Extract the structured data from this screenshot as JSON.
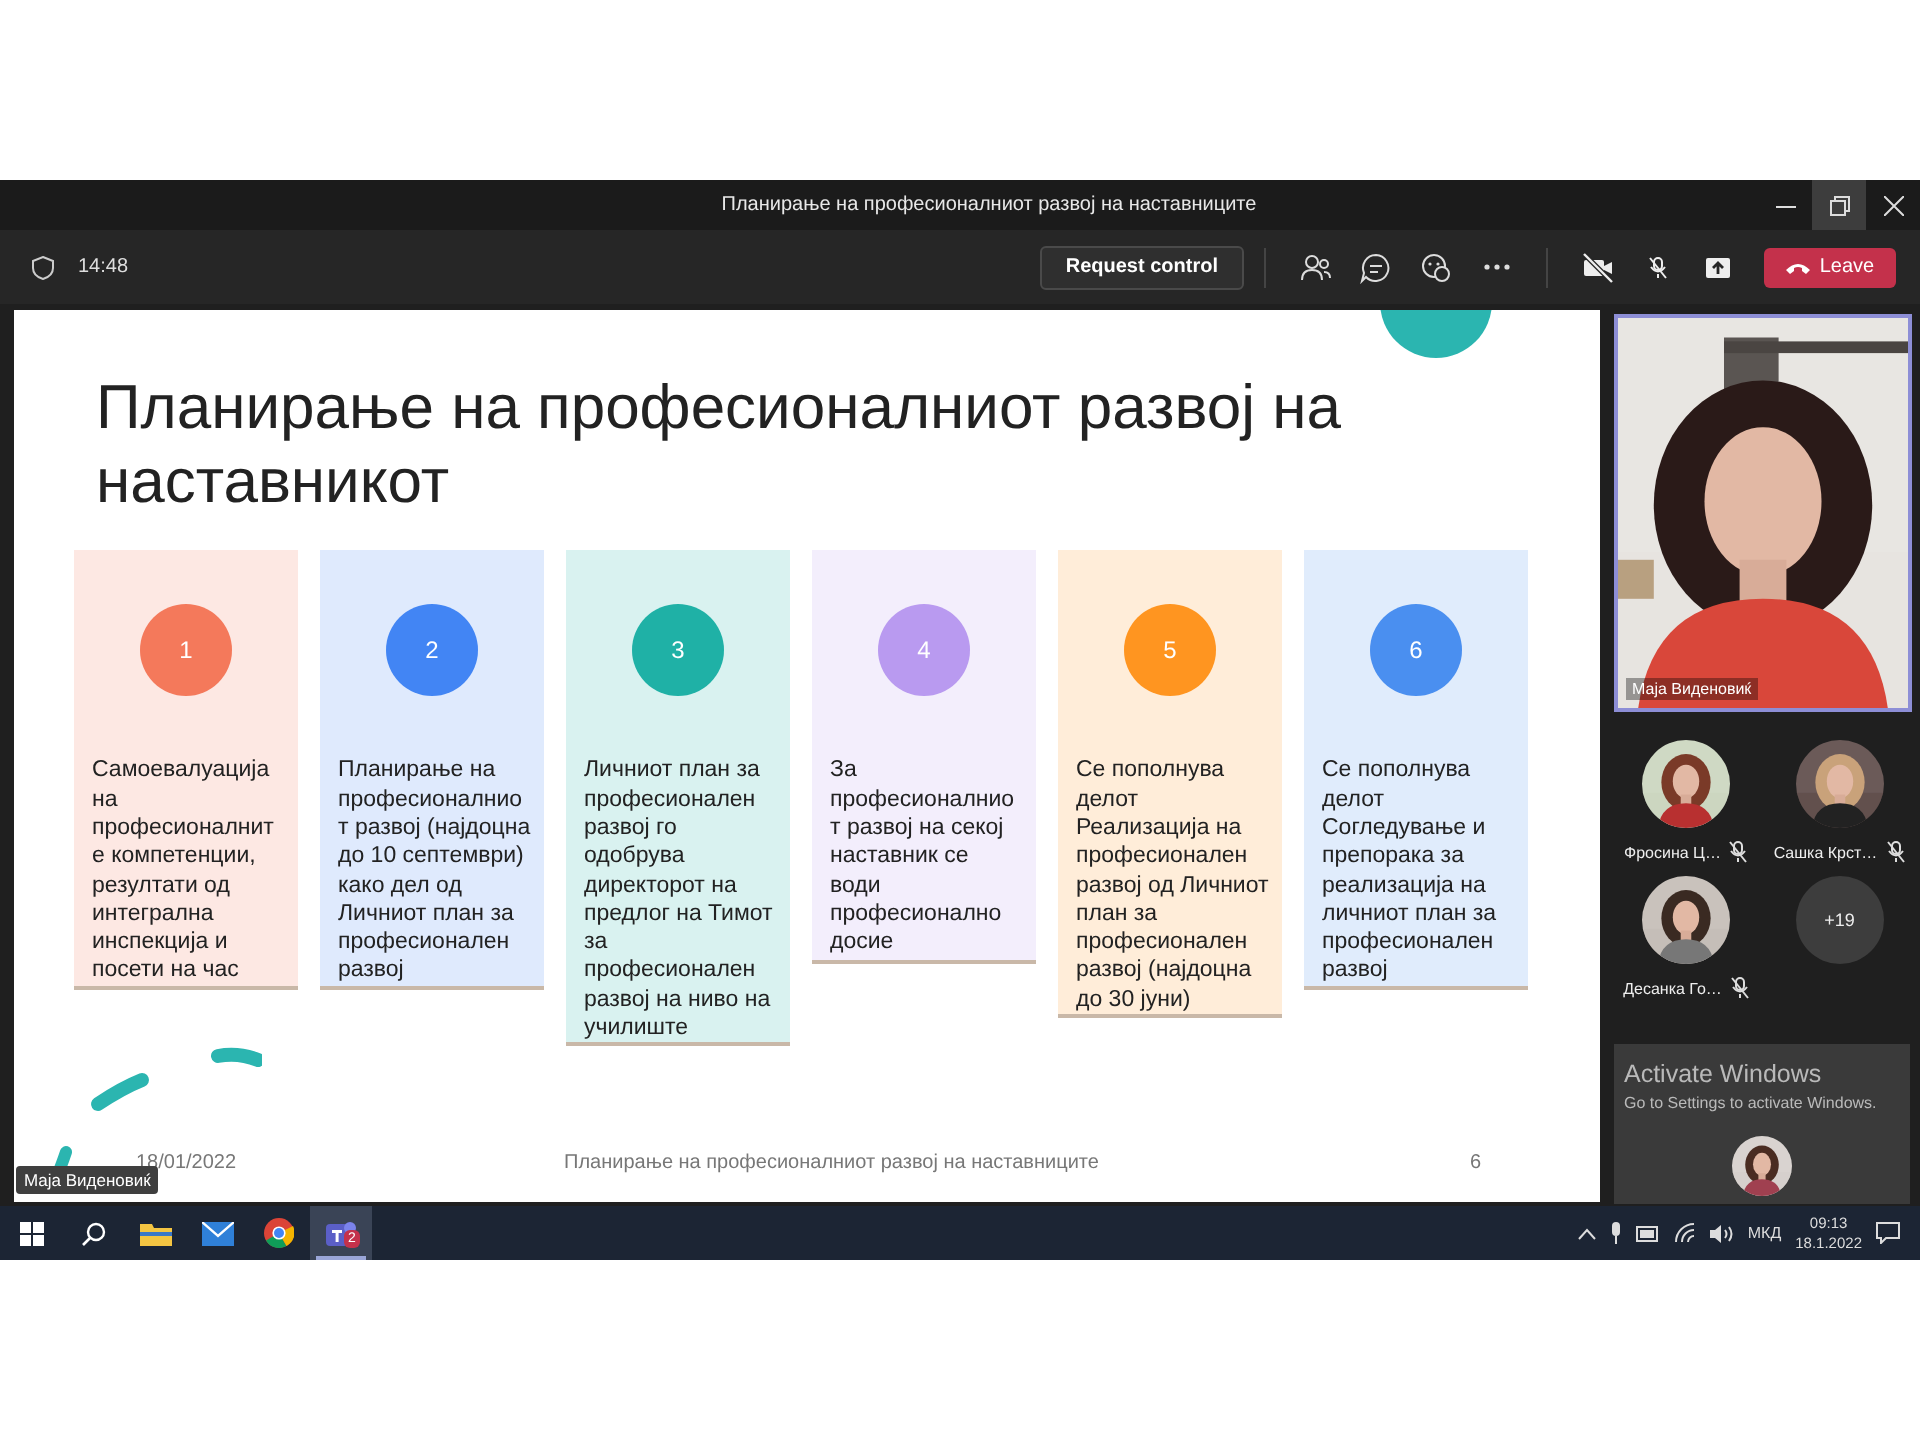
{
  "window": {
    "title": "Планирање на професионалниот развој на наставниците"
  },
  "toolbar": {
    "time": "14:48",
    "request_control": "Request control",
    "leave": "Leave",
    "camera_on": false,
    "mic_on": false
  },
  "slide": {
    "title": "Планирање на професионалниот развој на наставникот",
    "steps": [
      {
        "number": "1",
        "color": "#f4795b",
        "text": "Самоевалуација на професионалните компетенции, резултати од интегрална инспекција и посети на час"
      },
      {
        "number": "2",
        "color": "#4285f4",
        "text": "Планирање на професионалниот развој (најдоцна до 10 септември) како дел од Личниот план за професионален развој"
      },
      {
        "number": "3",
        "color": "#1fb1a6",
        "text": "Личниот план за професионален развој го одобрува директорот на предлог на Тимот за професионален развој на ниво на училиште"
      },
      {
        "number": "4",
        "color": "#b99af0",
        "text": "За професионалниот развој на секој наставник се води професионално досие"
      },
      {
        "number": "5",
        "color": "#ff9520",
        "text": "Се пополнува делот Реализација на професионален развој од Личниот план за професионален развој (најдоцна до 30 јуни)"
      },
      {
        "number": "6",
        "color": "#4a8ff0",
        "text": "Се пополнува делот Согледување и препорака за реализација на личниот план за професионален развој"
      }
    ],
    "footer": {
      "date": "18/01/2022",
      "title": "Планирање на професионалниот развој на наставниците",
      "page": "6"
    }
  },
  "presenter_tag": "Маја Виденовиќ",
  "participants": {
    "speaker": {
      "name": "Маја Виденовиќ"
    },
    "others": [
      {
        "name": "Фросина Ц…",
        "muted": true
      },
      {
        "name": "Сашка Крст…",
        "muted": true
      },
      {
        "name": "Десанка Го…",
        "muted": true
      }
    ],
    "overflow": "+19"
  },
  "activation": {
    "title": "Activate Windows",
    "subtitle": "Go to Settings to activate Windows."
  },
  "taskbar": {
    "apps": [
      {
        "kind": "explorer",
        "selected": false
      },
      {
        "kind": "mail",
        "selected": false
      },
      {
        "kind": "chrome",
        "selected": false
      },
      {
        "kind": "teams",
        "selected": true,
        "badge": "2"
      }
    ],
    "tray": {
      "language": "МКД",
      "time": "09:13",
      "date": "18.1.2022"
    }
  }
}
